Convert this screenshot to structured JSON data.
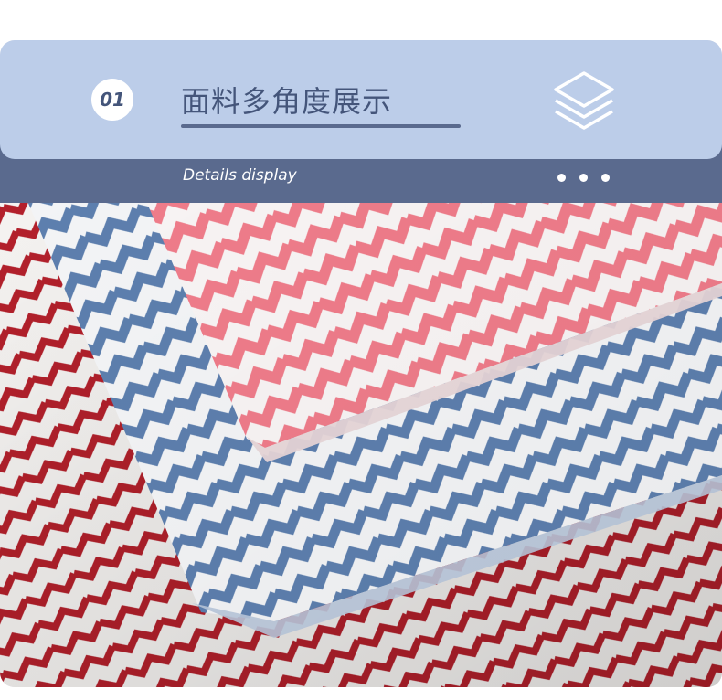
{
  "header": {
    "number": "01",
    "title": "面料多角度展示",
    "subtitle": "Details display",
    "icon": "layers-icon",
    "colors": {
      "header_light": "#bccde9",
      "header_dark": "#5a6a8e",
      "text_dark": "#44557a"
    }
  },
  "photo": {
    "icon": "fabric-photo",
    "fabrics": [
      {
        "color": "#b3202b"
      },
      {
        "color": "#5d7fae"
      },
      {
        "color": "#ef7c8a"
      }
    ]
  }
}
